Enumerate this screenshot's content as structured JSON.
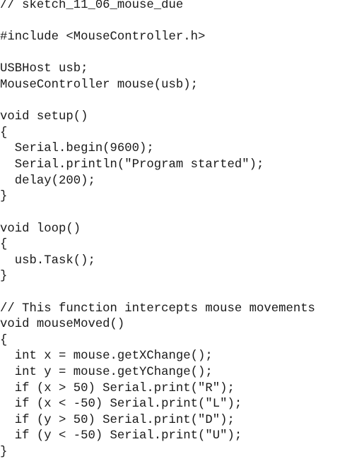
{
  "code": {
    "lines": [
      "// sketch_11_06_mouse_due",
      "",
      "#include <MouseController.h>",
      "",
      "USBHost usb;",
      "MouseController mouse(usb);",
      "",
      "void setup()",
      "{",
      "  Serial.begin(9600);",
      "  Serial.println(\"Program started\");",
      "  delay(200);",
      "}",
      "",
      "void loop()",
      "{",
      "  usb.Task();",
      "}",
      "",
      "// This function intercepts mouse movements",
      "void mouseMoved()",
      "{",
      "  int x = mouse.getXChange();",
      "  int y = mouse.getYChange();",
      "  if (x > 50) Serial.print(\"R\");",
      "  if (x < -50) Serial.print(\"L\");",
      "  if (y > 50) Serial.print(\"D\");",
      "  if (y < -50) Serial.print(\"U\");",
      "}"
    ]
  }
}
